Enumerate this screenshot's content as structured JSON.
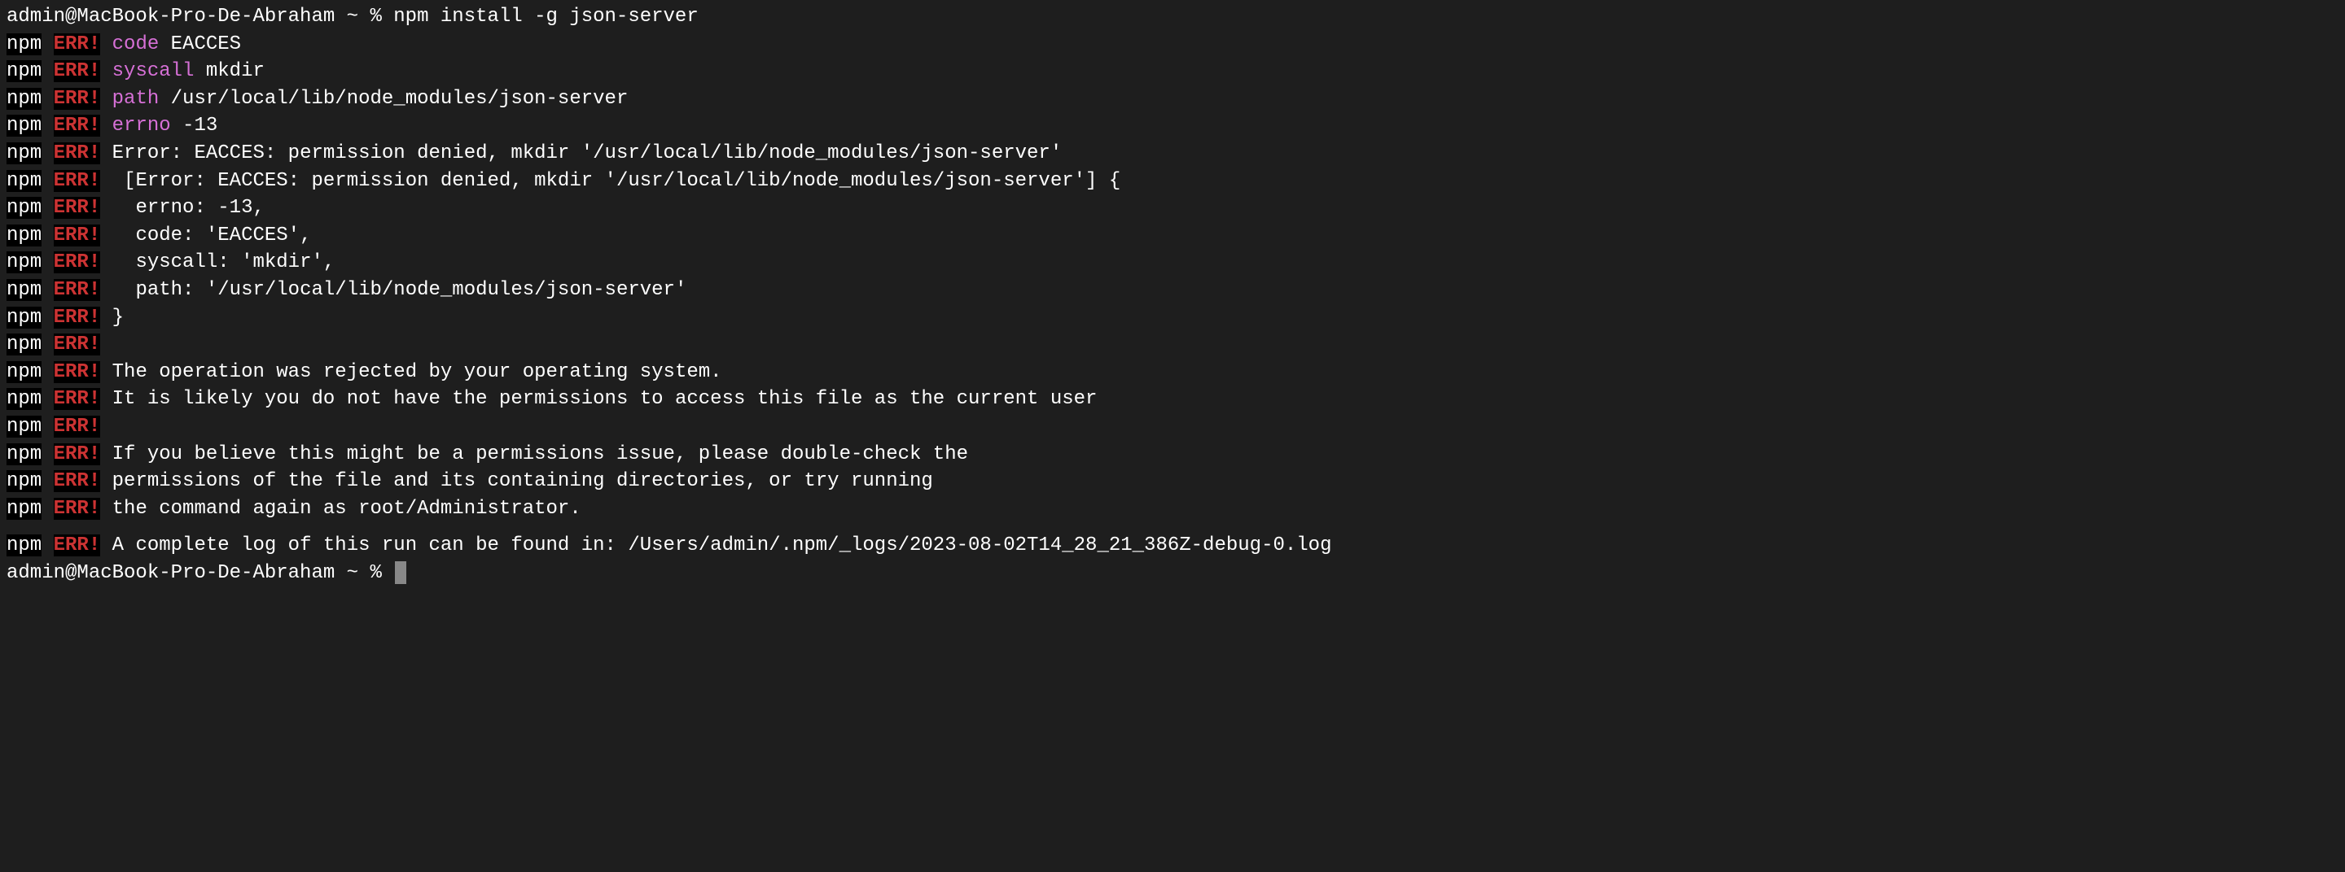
{
  "prompt1": "admin@MacBook-Pro-De-Abraham ~ % npm install -g json-server",
  "npm": "npm",
  "err": "ERR!",
  "lines": {
    "l1_key": "code",
    "l1_val": " EACCES",
    "l2_key": "syscall",
    "l2_val": " mkdir",
    "l3_key": "path",
    "l3_val": " /usr/local/lib/node_modules/json-server",
    "l4_key": "errno",
    "l4_val": " -13",
    "l5": "Error: EACCES: permission denied, mkdir '/usr/local/lib/node_modules/json-server'",
    "l6": " [Error: EACCES: permission denied, mkdir '/usr/local/lib/node_modules/json-server'] {",
    "l7": "  errno: -13,",
    "l8": "  code: 'EACCES',",
    "l9": "  syscall: 'mkdir',",
    "l10": "  path: '/usr/local/lib/node_modules/json-server'",
    "l11": "}",
    "l12": "",
    "l13": "The operation was rejected by your operating system.",
    "l14": "It is likely you do not have the permissions to access this file as the current user",
    "l15": "",
    "l16": "If you believe this might be a permissions issue, please double-check the",
    "l17": "permissions of the file and its containing directories, or try running",
    "l18": "the command again as root/Administrator.",
    "l19": "A complete log of this run can be found in: /Users/admin/.npm/_logs/2023-08-02T14_28_21_386Z-debug-0.log"
  },
  "prompt2": "admin@MacBook-Pro-De-Abraham ~ % "
}
